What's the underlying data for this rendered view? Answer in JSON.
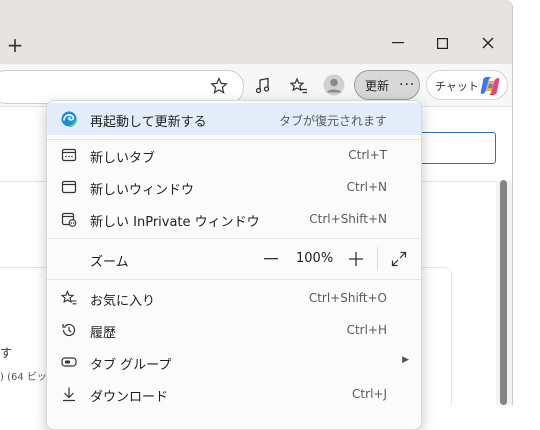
{
  "window": {
    "new_tab": "+",
    "minimize": "—",
    "maximize": "☐",
    "close": "✕"
  },
  "toolbar": {
    "update_label": "更新",
    "more_label": "···",
    "chat_label": "チャット"
  },
  "background": {
    "text_line1": "す",
    "text_line2": ") (64 ビッ"
  },
  "menu": {
    "restart": {
      "label": "再起動して更新する",
      "hint": "タブが復元されます"
    },
    "new_tab": {
      "label": "新しいタブ",
      "shortcut": "Ctrl+T"
    },
    "new_window": {
      "label": "新しいウィンドウ",
      "shortcut": "Ctrl+N"
    },
    "new_inprivate": {
      "label": "新しい InPrivate ウィンドウ",
      "shortcut": "Ctrl+Shift+N"
    },
    "zoom": {
      "label": "ズーム",
      "minus": "—",
      "value": "100%",
      "plus": "+"
    },
    "favorites": {
      "label": "お気に入り",
      "shortcut": "Ctrl+Shift+O"
    },
    "history": {
      "label": "履歴",
      "shortcut": "Ctrl+H"
    },
    "tab_groups": {
      "label": "タブ グループ",
      "arrow": "▶"
    },
    "downloads": {
      "label": "ダウンロード",
      "shortcut": "Ctrl+J"
    }
  },
  "colors": {
    "highlight": "#e3ecf9",
    "accent": "#0f6cbd"
  }
}
